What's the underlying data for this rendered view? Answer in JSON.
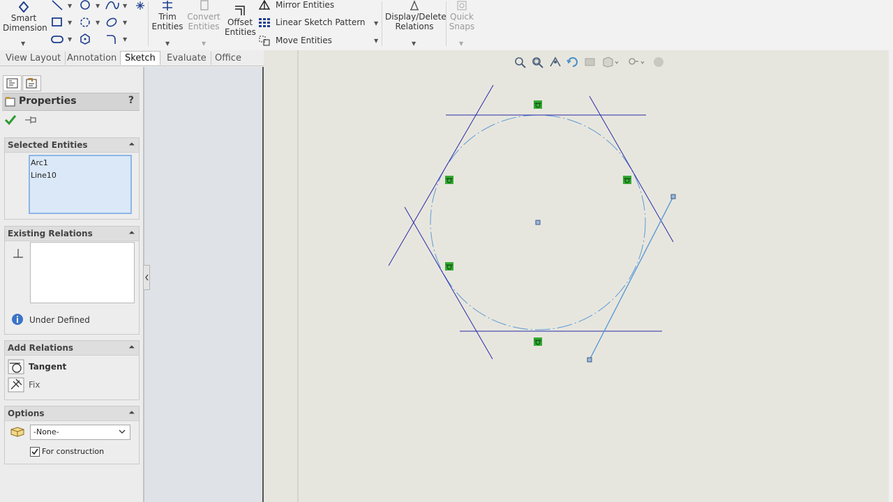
{
  "ribbon": {
    "smart_dimension": "Smart\nDimension",
    "trim_entities": "Trim\nEntities",
    "convert_entities": "Convert\nEntities",
    "offset_entities": "Offset\nEntities",
    "mirror_entities": "Mirror Entities",
    "linear_sketch_pattern": "Linear Sketch Pattern",
    "move_entities": "Move Entities",
    "display_delete_relations": "Display/Delete\nRelations",
    "quick_snaps": "Quick\nSnaps"
  },
  "tabs": [
    "View Layout",
    "Annotation",
    "Sketch",
    "Evaluate",
    "Office Products"
  ],
  "active_tab": "Sketch",
  "property_manager": {
    "title": "Properties",
    "help": "?",
    "selected_entities": {
      "title": "Selected Entities",
      "items": [
        "Arc1",
        "Line10"
      ]
    },
    "existing_relations": {
      "title": "Existing Relations",
      "status": "Under Defined"
    },
    "add_relations": {
      "title": "Add Relations",
      "items": [
        "Tangent",
        "Fix"
      ]
    },
    "options": {
      "title": "Options",
      "layer_value": "-None-",
      "for_construction_label": "For construction",
      "for_construction_checked": true
    }
  },
  "colors": {
    "sketch_line": "#2a2aa8",
    "construction_line": "#5b9bd5",
    "relation_badge": "#33aa33",
    "viewport_bg": "#e7e6de"
  }
}
